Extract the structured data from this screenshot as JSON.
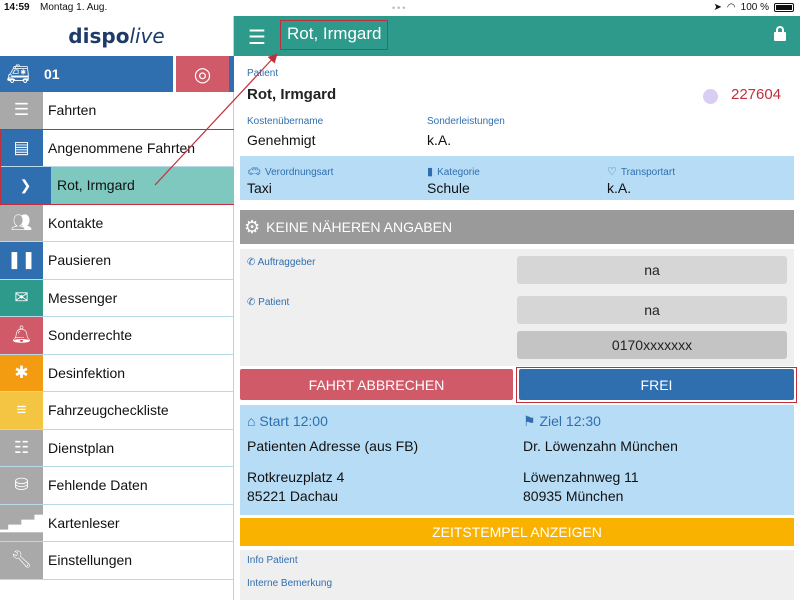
{
  "statusbar": {
    "time": "14:59",
    "date": "Montag 1. Aug.",
    "battery": "100 %"
  },
  "logo": {
    "part1": "dispo",
    "part2": "live"
  },
  "vehicle": {
    "number": "01"
  },
  "menu": {
    "items": [
      {
        "label": "Fahrten",
        "icon": "list-icon",
        "color": "#a9a9a9"
      },
      {
        "label": "Angenommene Fahrten",
        "icon": "id-card-icon",
        "color": "#2f6fb0"
      },
      {
        "label": "Rot, Irmgard",
        "icon": "chevron-right-icon",
        "color": "#2f6fb0"
      },
      {
        "label": "Kontakte",
        "icon": "people-icon",
        "color": "#a9a9a9"
      },
      {
        "label": "Pausieren",
        "icon": "pause-icon",
        "color": "#2f6fb0"
      },
      {
        "label": "Messenger",
        "icon": "envelope-icon",
        "color": "#2e9a8c"
      },
      {
        "label": "Sonderrechte",
        "icon": "bell-icon",
        "color": "#d05a68"
      },
      {
        "label": "Desinfektion",
        "icon": "bug-icon",
        "color": "#f39c12"
      },
      {
        "label": "Fahrzeugcheckliste",
        "icon": "checklist-icon",
        "color": "#f4c542"
      },
      {
        "label": "Dienstplan",
        "icon": "list-icon",
        "color": "#a9a9a9"
      },
      {
        "label": "Fehlende Daten",
        "icon": "database-icon",
        "color": "#a9a9a9"
      },
      {
        "label": "Kartenleser",
        "icon": "signal-bars-icon",
        "color": "#a9a9a9"
      },
      {
        "label": "Einstellungen",
        "icon": "wrench-icon",
        "color": "#a9a9a9"
      }
    ]
  },
  "header": {
    "title": "Rot, Irmgard"
  },
  "patient": {
    "label": "Patient",
    "name": "Rot, Irmgard",
    "number": "227604"
  },
  "coverage": {
    "kosten_label": "Kostenübername",
    "kosten_value": "Genehmigt",
    "sonder_label": "Sonderleistungen",
    "sonder_value": "k.A."
  },
  "details": {
    "verordnung_label": "Verordnungsart",
    "verordnung_value": "Taxi",
    "kategorie_label": "Kategorie",
    "kategorie_value": "Schule",
    "transport_label": "Transportart",
    "transport_value": "k.A."
  },
  "notes_header": "KEINE NÄHEREN ANGABEN",
  "contacts": {
    "auftraggeber_label": "Auftraggeber",
    "auftraggeber_value": "na",
    "patient_label": "Patient",
    "patient_value": "na",
    "patient_phone": "0170xxxxxxx"
  },
  "actions": {
    "cancel": "FAHRT ABBRECHEN",
    "free": "FREI"
  },
  "route": {
    "start_label": "Start 12:00",
    "start_name": "Patienten Adresse (aus FB)",
    "start_street": "Rotkreuzplatz 4",
    "start_city": "85221 Dachau",
    "ziel_label": "Ziel 12:30",
    "ziel_name": "Dr. Löwenzahn München",
    "ziel_street": "Löwenzahnweg 11",
    "ziel_city": "80935 München"
  },
  "timestamps_button": "ZEITSTEMPEL ANZEIGEN",
  "info": {
    "info_patient": "Info Patient",
    "interne_bemerkung": "Interne Bemerkung"
  },
  "colors": {
    "teal": "#2e9a8c",
    "blue": "#2f6fb0",
    "red": "#d05a68",
    "orange": "#f9b200",
    "lightblue": "#b7dcf5"
  }
}
